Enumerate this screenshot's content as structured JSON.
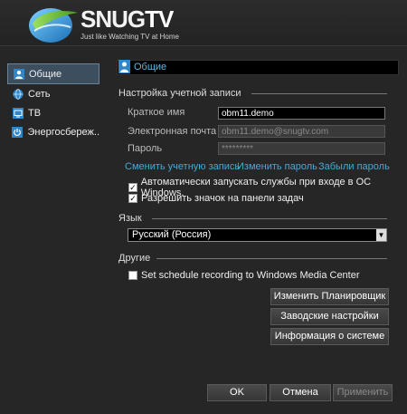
{
  "header": {
    "brand_snug": "SNUG",
    "brand_tv": "TV",
    "slogan": "Just like Watching TV at Home"
  },
  "sidebar": {
    "items": [
      {
        "label": "Общие",
        "icon": "user-icon",
        "active": true
      },
      {
        "label": "Сеть",
        "icon": "globe-icon",
        "active": false
      },
      {
        "label": "ТВ",
        "icon": "tv-icon",
        "active": false
      },
      {
        "label": "Энергосбереж...",
        "icon": "power-icon",
        "active": false
      }
    ]
  },
  "panel": {
    "title": "Общие",
    "account_section": "Настройка учетной записи",
    "short_name_label": "Краткое имя",
    "short_name_value": "obm11.demo",
    "email_label": "Электронная почта",
    "email_value": "obm11.demo@snugtv.com",
    "password_label": "Пароль",
    "password_value": "*********",
    "links": {
      "change_account": "Сменить учетную запись",
      "change_password": "Изменить пароль",
      "forgot_password": "Забыли пароль"
    },
    "autostart_label": "Автоматически запускать службы при входе в ОС Windows.",
    "autostart_checked": true,
    "tray_icon_label": "Разрешить значок на панели задач",
    "tray_icon_checked": true,
    "language_section": "Язык",
    "language_value": "Русский (Россия)",
    "other_section": "Другие",
    "wmc_label": "Set schedule recording to Windows Media Center",
    "wmc_checked": false,
    "buttons": {
      "scheduler": "Изменить Планировщик",
      "factory": "Заводские настройки",
      "system_info": "Информация о системе"
    }
  },
  "footer": {
    "ok": "OK",
    "cancel": "Отмена",
    "apply": "Применить"
  },
  "colors": {
    "accent_link": "#4aa7d8",
    "active_sidebar": "#3d4f5e",
    "background": "#2a2a2a"
  }
}
